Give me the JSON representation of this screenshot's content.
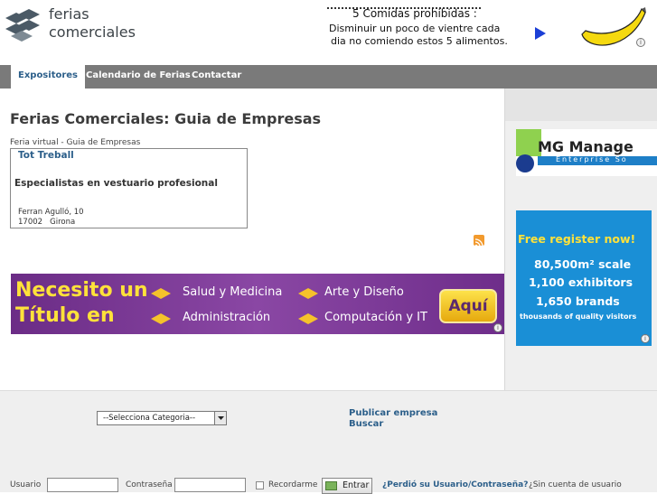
{
  "header": {
    "logo_line1": "ferias",
    "logo_line2": "comerciales",
    "top_ad": {
      "line1": "5 Comidas prohibidas :",
      "line2": "Disminuir un poco de vientre cada",
      "line3": "dia no comiendo estos 5 alimentos."
    }
  },
  "nav": {
    "items": [
      {
        "label": "Expositores",
        "active": true
      },
      {
        "label": "Calendario de Ferias",
        "active": false
      },
      {
        "label": "Contactar",
        "active": false
      }
    ]
  },
  "main": {
    "title": "Ferias Comerciales: Guia de Empresas",
    "breadcrumb": "Feria virtual - Guia de Empresas",
    "company": {
      "name": "Tot Treball",
      "description": "Especialistas en vestuario profesional",
      "address": "Ferran Agulló, 10",
      "city": "17002   Girona"
    }
  },
  "banner_ad": {
    "line1": "Necesito un",
    "line2": "Título en",
    "items": [
      "Salud y Medicina",
      "Arte y Diseño",
      "Administración",
      "Computación y IT"
    ],
    "cta": "Aquí"
  },
  "sidebar": {
    "ad1_text": "MG Manage",
    "ad1_sub": "Enterprise So",
    "ad2": {
      "headline": "Free register now!",
      "line1": "80,500m² scale",
      "line2": "1,100 exhibitors",
      "line3": "1,650 brands",
      "line4": "thousands of quality visitors"
    }
  },
  "footer": {
    "category_select": "--Selecciona Categoria--",
    "publish_link": "Publicar empresa",
    "search_link": "Buscar",
    "login": {
      "user_label": "Usuario",
      "password_label": "Contraseña",
      "remember_label": "Recordarme",
      "enter_button": "Entrar",
      "forgot_link": "¿Perdió su Usuario/Contraseña?",
      "no_account": "¿Sin cuenta de usuario"
    }
  },
  "colors": {
    "nav_bg": "#7a7a7a",
    "link": "#2c5f8a",
    "banner_purple": "#7a3a96",
    "banner_yellow": "#ffe23a",
    "sidebar_ad_blue": "#1a8fd6"
  }
}
